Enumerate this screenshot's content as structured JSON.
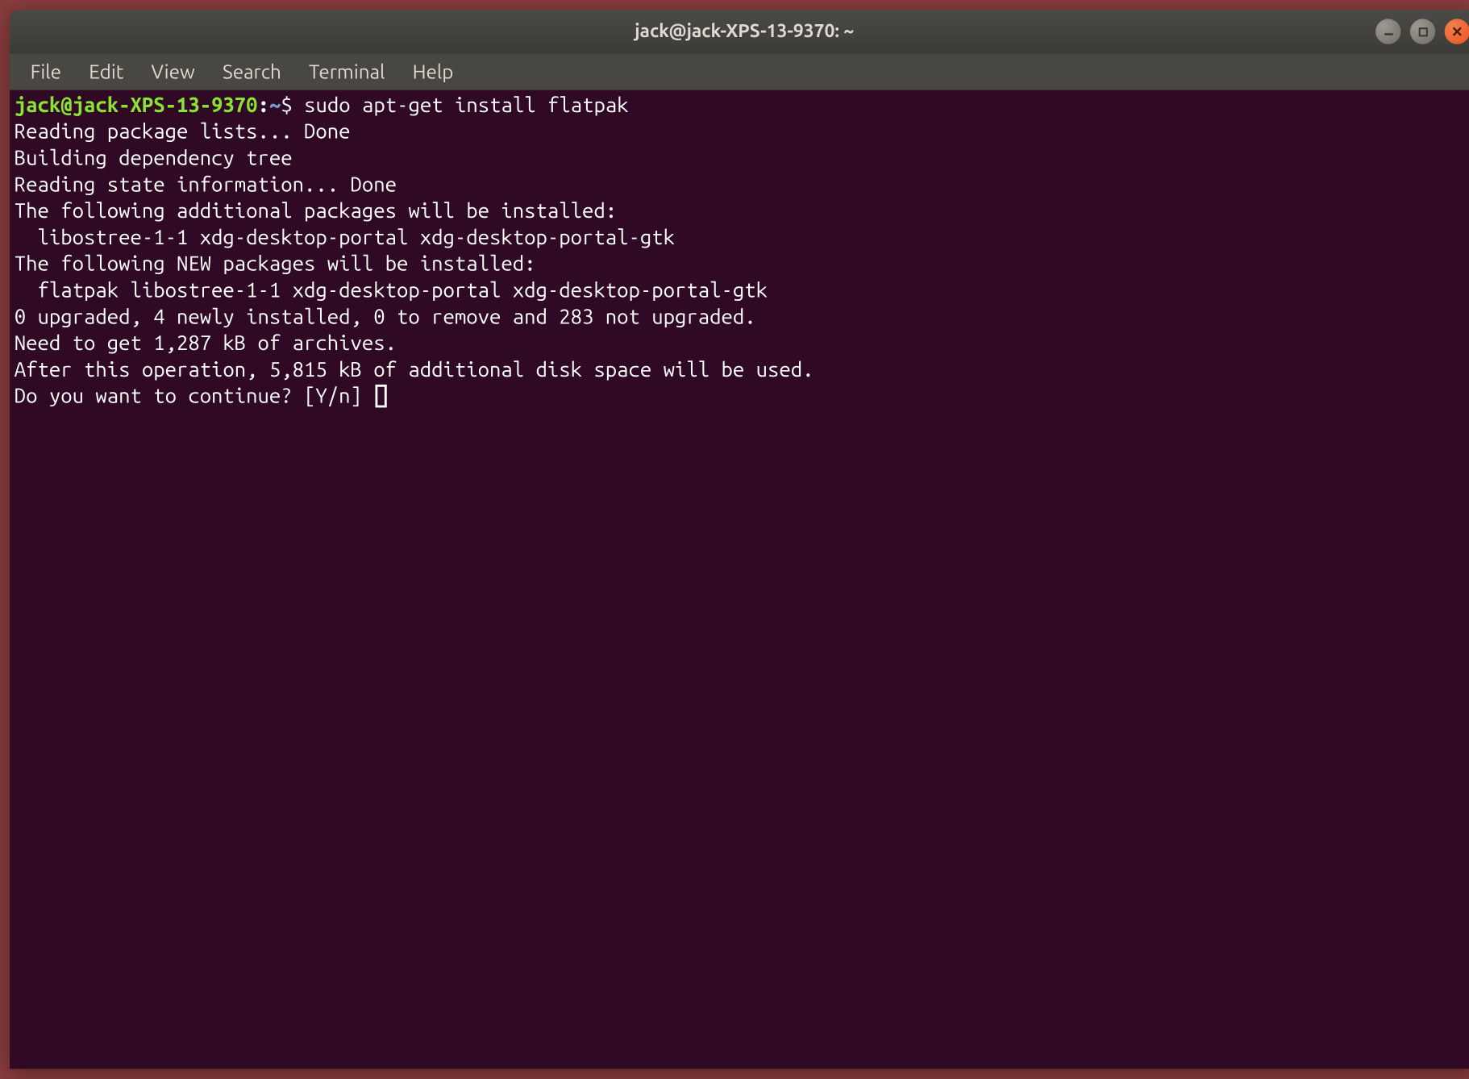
{
  "window": {
    "title": "jack@jack-XPS-13-9370: ~"
  },
  "menu": {
    "items": [
      "File",
      "Edit",
      "View",
      "Search",
      "Terminal",
      "Help"
    ]
  },
  "prompt": {
    "user_host": "jack@jack-XPS-13-9370",
    "separator": ":",
    "path": "~",
    "symbol": "$"
  },
  "command": "sudo apt-get install flatpak",
  "output_lines": [
    "Reading package lists... Done",
    "Building dependency tree",
    "Reading state information... Done",
    "The following additional packages will be installed:",
    "  libostree-1-1 xdg-desktop-portal xdg-desktop-portal-gtk",
    "The following NEW packages will be installed:",
    "  flatpak libostree-1-1 xdg-desktop-portal xdg-desktop-portal-gtk",
    "0 upgraded, 4 newly installed, 0 to remove and 283 not upgraded.",
    "Need to get 1,287 kB of archives.",
    "After this operation, 5,815 kB of additional disk space will be used.",
    "Do you want to continue? [Y/n] "
  ],
  "colors": {
    "terminal_bg": "#300a24",
    "prompt_user": "#8ae234",
    "prompt_path": "#729fcf",
    "accent_close": "#e95420"
  }
}
